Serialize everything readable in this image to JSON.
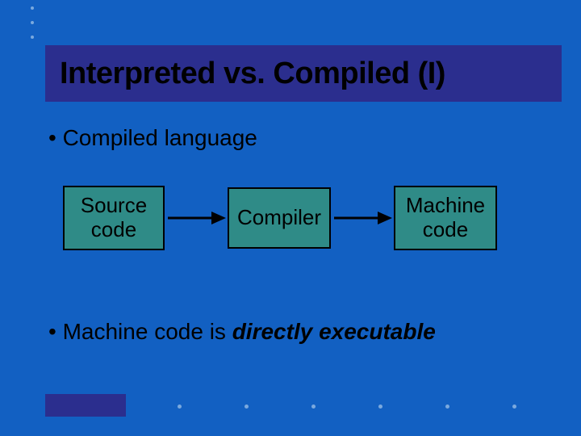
{
  "title": "Interpreted vs. Compiled (I)",
  "bullets": {
    "b1": "• Compiled language",
    "b2_prefix": "• Machine code is ",
    "b2_em": "directly executable"
  },
  "diagram": {
    "box1_l1": "Source",
    "box1_l2": "code",
    "box2": "Compiler",
    "box3_l1": "Machine",
    "box3_l2": "code"
  },
  "colors": {
    "bg": "#1260c2",
    "accent": "#2b2e8e",
    "box": "#2f8b87"
  }
}
